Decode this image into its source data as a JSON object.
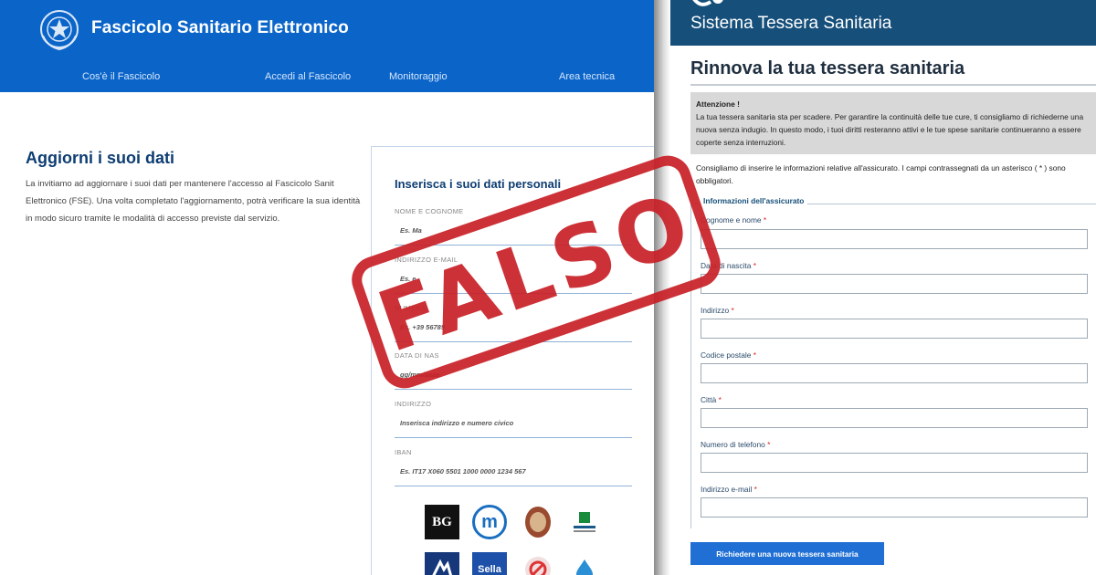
{
  "fse": {
    "title": "Fascicolo Sanitario Elettronico",
    "nav": [
      "Cos'è il Fascicolo",
      "Accedi al Fascicolo",
      "Monitoraggio",
      "Area tecnica"
    ],
    "heading": "Aggiorni i suoi dati",
    "intro": "La invitiamo ad aggiornare i suoi dati per mantenere l'accesso al Fascicolo Sanit Elettronico (FSE). Una volta completato l'aggiornamento, potrà verificare la sua identità in modo sicuro tramite le modalità di accesso previste dal servizio.",
    "form_title": "Inserisca i suoi dati personali",
    "fields": [
      {
        "label": "NOME E COGNOME",
        "value": "Es. Ma"
      },
      {
        "label": "INDIRIZZO E-MAIL",
        "value": "Es. e"
      },
      {
        "label": "NUMERO",
        "value": "Es. +39 56789"
      },
      {
        "label": "DATA DI NAS",
        "value": "gg/mm/aaaa"
      },
      {
        "label": "INDIRIZZO",
        "value": "Inserisca indirizzo e numero civico"
      },
      {
        "label": "IBAN",
        "value": "Es. IT17 X060 5501 1000 0000 1234 567"
      }
    ],
    "bank_logos": [
      {
        "text": "BG",
        "icon": "bg-bank-logo"
      },
      {
        "text": "m",
        "icon": "mediolanum-logo"
      },
      {
        "text": "",
        "icon": "seal-bank-logo"
      },
      {
        "text": "",
        "icon": "green-bank-logo"
      },
      {
        "text": "",
        "icon": "blue-bank-logo"
      },
      {
        "text": "Sella",
        "icon": "sella-logo"
      },
      {
        "text": "",
        "icon": "red-circle-logo"
      },
      {
        "text": "",
        "icon": "blue-drop-logo"
      }
    ],
    "colors": {
      "header": "#0b65c9",
      "heading": "#0d3d72"
    }
  },
  "ts": {
    "title": "Sistema Tessera Sanitaria",
    "heading": "Rinnova la tua tessera sanitaria",
    "alert_title": "Attenzione !",
    "alert_text": "La tua tessera sanitaria sta per scadere. Per garantire la continuità delle tue cure, ti consigliamo di richiederne una nuova senza indugio. In questo modo, i tuoi diritti resteranno attivi e le tue spese sanitarie continueranno a essere coperte senza interruzioni.",
    "instructions": "Consigliamo di inserire le informazioni relative all'assicurato. I campi contrassegnati da un asterisco ( * ) sono obbligatori.",
    "section_title": "Informazioni dell'assicurato",
    "fields": [
      {
        "label": "Cognome e nome",
        "required": "*"
      },
      {
        "label": "Data di nascita",
        "required": "*"
      },
      {
        "label": "Indirizzo",
        "required": "*"
      },
      {
        "label": "Codice postale",
        "required": "*"
      },
      {
        "label": "Città",
        "required": "*"
      },
      {
        "label": "Numero di telefono",
        "required": "*"
      },
      {
        "label": "Indirizzo e-mail",
        "required": "*"
      }
    ],
    "submit_label": "Richiedere una nuova tessera sanitaria",
    "colors": {
      "header": "#164f7a",
      "button": "#1f6fd4"
    }
  },
  "stamp": {
    "text": "FALSO",
    "color": "#c82026"
  }
}
